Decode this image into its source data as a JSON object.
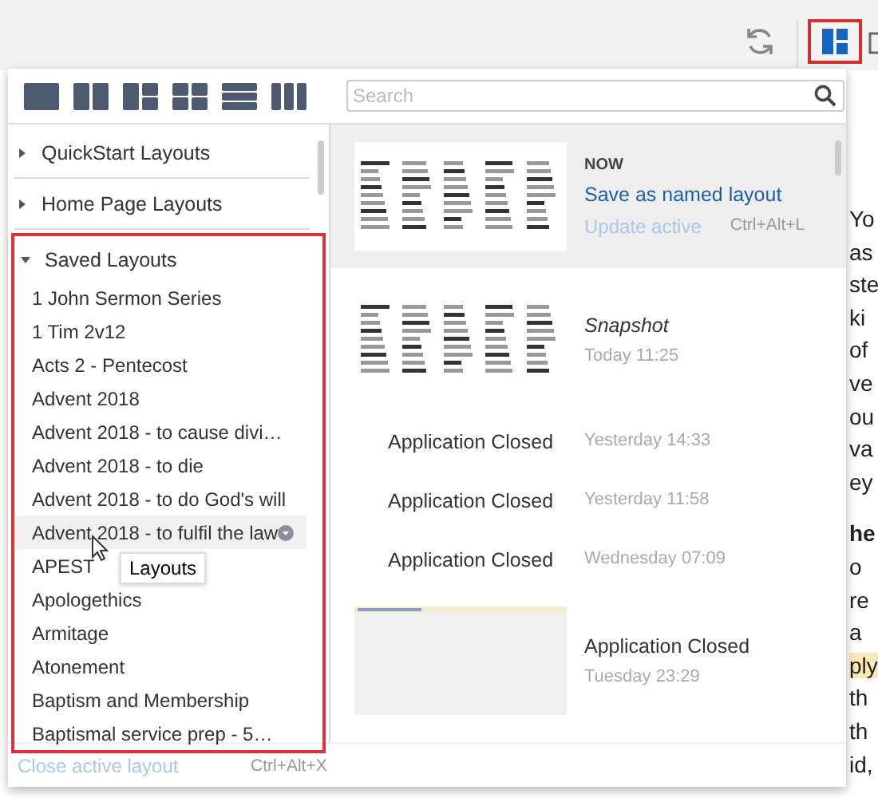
{
  "toolbar": {
    "buttons": [
      {
        "kind": "refresh",
        "selected": false
      },
      {
        "kind": "layouts",
        "selected": true
      }
    ]
  },
  "layout_presets": [
    {
      "kind": "single"
    },
    {
      "kind": "two-columns"
    },
    {
      "kind": "column-and-two-panes"
    },
    {
      "kind": "grid"
    },
    {
      "kind": "rows"
    },
    {
      "kind": "three-columns"
    }
  ],
  "search": {
    "placeholder": "Search"
  },
  "groups": [
    {
      "label": "QuickStart Layouts",
      "expanded": false
    },
    {
      "label": "Home Page Layouts",
      "expanded": false
    },
    {
      "label": "Saved Layouts",
      "expanded": true,
      "children": [
        {
          "label": "1 John Sermon Series",
          "hovered": false
        },
        {
          "label": "1 Tim 2v12",
          "hovered": false
        },
        {
          "label": "Acts 2 - Pentecost",
          "hovered": false
        },
        {
          "label": "Advent 2018",
          "hovered": false
        },
        {
          "label": "Advent 2018 - to cause divi…",
          "hovered": false
        },
        {
          "label": "Advent 2018 - to die",
          "hovered": false
        },
        {
          "label": "Advent 2018 - to do God's will",
          "hovered": false
        },
        {
          "label": "Advent 2018 - to fulfil the law",
          "hovered": true
        },
        {
          "label": "APEST",
          "hovered": false
        },
        {
          "label": "Apologethics",
          "hovered": false
        },
        {
          "label": "Armitage",
          "hovered": false
        },
        {
          "label": "Atonement",
          "hovered": false
        },
        {
          "label": "Baptism and Membership",
          "hovered": false
        },
        {
          "label": "Baptismal service prep - 5…",
          "hovered": false
        }
      ]
    }
  ],
  "tooltip": "Layouts",
  "history": [
    {
      "kind": "current",
      "label": "NOW",
      "title": "Save as named layout",
      "action": "Update active",
      "shortcut": "Ctrl+Alt+L",
      "thumbnail": true
    },
    {
      "kind": "snapshot",
      "title": "Snapshot",
      "time": "Today 11:25",
      "thumbnail": true
    },
    {
      "kind": "closed",
      "title": "Application Closed",
      "time": "Yesterday 14:33"
    },
    {
      "kind": "closed",
      "title": "Application Closed",
      "time": "Yesterday 11:58"
    },
    {
      "kind": "closed",
      "title": "Application Closed",
      "time": "Wednesday 07:09"
    },
    {
      "kind": "closed",
      "title": "Application Closed",
      "time": "Tuesday 23:29",
      "thumbnail": true
    }
  ],
  "footer": {
    "close": "Close active layout",
    "shortcut": "Ctrl+Alt+X"
  },
  "background_document": {
    "lines": [
      {
        "text": "Yo",
        "kind": "normal"
      },
      {
        "text": "as",
        "kind": "normal"
      },
      {
        "text": "ste",
        "kind": "normal"
      },
      {
        "text": "ki",
        "kind": "normal"
      },
      {
        "text": "of",
        "kind": "normal"
      },
      {
        "text": "ve",
        "kind": "normal"
      },
      {
        "text": "ou",
        "kind": "normal"
      },
      {
        "text": "va",
        "kind": "normal"
      },
      {
        "text": "ey",
        "kind": "normal"
      },
      {
        "text": "he",
        "kind": "bold"
      },
      {
        "text": "o",
        "kind": "normal"
      },
      {
        "text": "re",
        "kind": "normal"
      },
      {
        "text": "a",
        "kind": "normal"
      },
      {
        "text": "ply",
        "kind": "highlight"
      },
      {
        "text": "th",
        "kind": "normal"
      },
      {
        "text": "th",
        "kind": "normal"
      },
      {
        "text": "id,",
        "kind": "normal"
      }
    ]
  }
}
